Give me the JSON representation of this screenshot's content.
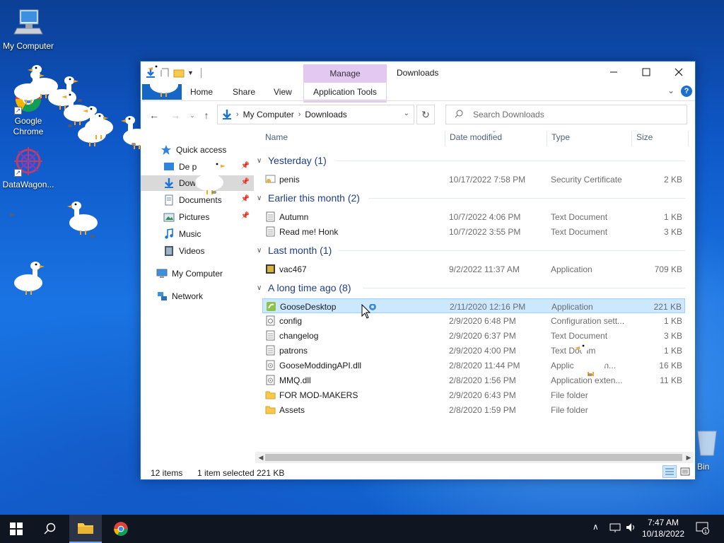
{
  "desktop": {
    "icons": [
      {
        "label": "My Computer",
        "icon": "computer-icon"
      },
      {
        "label": "Google Chrome",
        "icon": "chrome-icon"
      },
      {
        "label": "DataWagon...",
        "icon": "datawagon-icon"
      }
    ],
    "recycle_bin_label": "Bin"
  },
  "window": {
    "title": "Downloads",
    "contextual_tab": "Manage",
    "ribbon_tabs": [
      "Home",
      "Share",
      "View"
    ],
    "app_tools_tab": "Application Tools",
    "address": {
      "root": "My Computer",
      "current": "Downloads"
    },
    "search_placeholder": "Search Downloads"
  },
  "nav": {
    "quick_access": "Quick access",
    "items": [
      {
        "label": "Desktop",
        "shown": "De   p",
        "pinned": true
      },
      {
        "label": "Downloads",
        "shown": "Dow",
        "pinned": true,
        "selected": true
      },
      {
        "label": "Documents",
        "shown": "Documents",
        "pinned": true
      },
      {
        "label": "Pictures",
        "shown": "Pictures",
        "pinned": true
      },
      {
        "label": "Music",
        "shown": "Music",
        "pinned": false
      },
      {
        "label": "Videos",
        "shown": "Videos",
        "pinned": false
      }
    ],
    "my_computer": "My Computer",
    "network": "Network"
  },
  "columns": {
    "name": "Name",
    "date": "Date modified",
    "type": "Type",
    "size": "Size"
  },
  "groups": [
    {
      "title": "Yesterday (1)",
      "rows": [
        {
          "name": "penis",
          "date": "10/17/2022 7:58 PM",
          "type": "Security Certificate",
          "size": "2 KB",
          "icon": "certificate"
        }
      ]
    },
    {
      "title": "Earlier this month (2)",
      "rows": [
        {
          "name": "Autumn",
          "date": "10/7/2022 4:06 PM",
          "type": "Text Document",
          "size": "1 KB",
          "icon": "text"
        },
        {
          "name": "Read me! Honk",
          "date": "10/7/2022 3:55 PM",
          "type": "Text Document",
          "size": "3 KB",
          "icon": "text"
        }
      ]
    },
    {
      "title": "Last month (1)",
      "rows": [
        {
          "name": "vac467",
          "date": "9/2/2022 11:37 AM",
          "type": "Application",
          "size": "709 KB",
          "icon": "app"
        }
      ]
    },
    {
      "title": "A long time ago (8)",
      "rows": [
        {
          "name": "GooseDesktop",
          "date": "2/11/2020 12:16 PM",
          "type": "Application",
          "size": "221 KB",
          "icon": "goose-app",
          "selected": true
        },
        {
          "name": "config",
          "date": "2/9/2020 6:48 PM",
          "type": "Configuration sett...",
          "size": "1 KB",
          "icon": "config"
        },
        {
          "name": "changelog",
          "date": "2/9/2020 6:37 PM",
          "type": "Text Document",
          "size": "3 KB",
          "icon": "text"
        },
        {
          "name": "patrons",
          "date": "2/9/2020 4:00 PM",
          "type": "Text Docum",
          "size": "1 KB",
          "icon": "text"
        },
        {
          "name": "GooseModdingAPI.dll",
          "date": "2/8/2020 11:44 PM",
          "type": "Applic        xten...",
          "size": "16 KB",
          "icon": "dll"
        },
        {
          "name": "MMQ.dll",
          "date": "2/8/2020 1:56 PM",
          "type": "Application exten...",
          "size": "11 KB",
          "icon": "dll"
        },
        {
          "name": "FOR MOD-MAKERS",
          "date": "2/9/2020 6:43 PM",
          "type": "File folder",
          "size": "",
          "icon": "folder"
        },
        {
          "name": "Assets",
          "date": "2/8/2020 1:59 PM",
          "type": "File folder",
          "size": "",
          "icon": "folder"
        }
      ]
    }
  ],
  "status": {
    "items": "12 items",
    "selected": "1 item selected",
    "size": "221 KB"
  },
  "taskbar": {
    "time": "7:47 AM",
    "date": "10/18/2022",
    "notifications": "1"
  },
  "colors": {
    "accent": "#1666c5",
    "manage": "#e3c8f2",
    "selection": "#cce8ff",
    "taskbar": "#101522"
  }
}
